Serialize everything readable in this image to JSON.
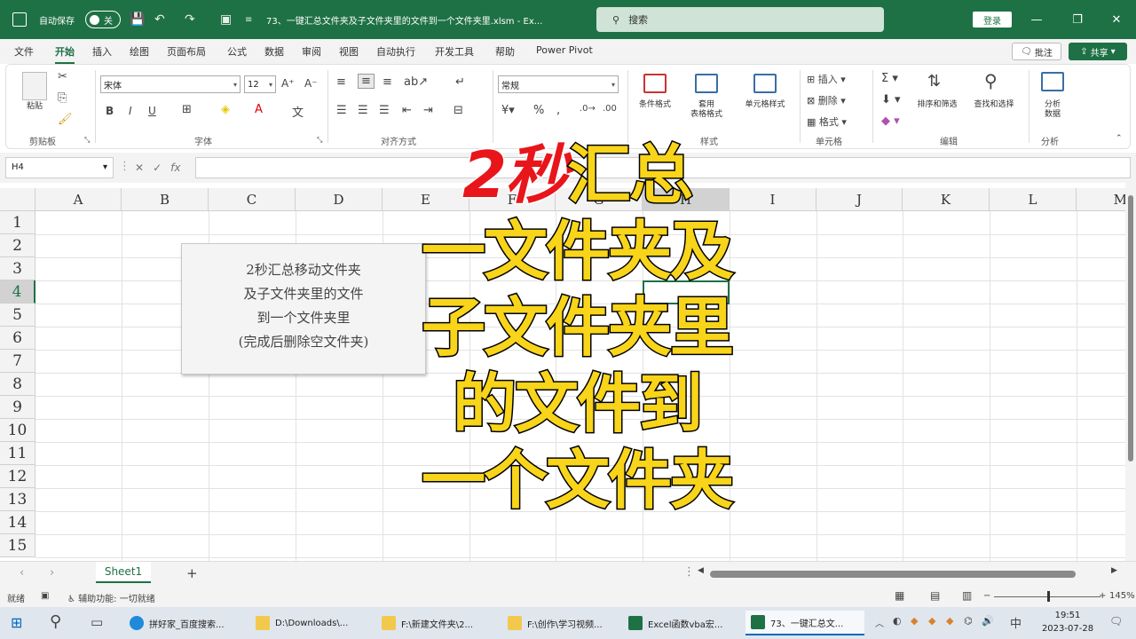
{
  "titlebar": {
    "autosave_label": "自动保存",
    "autosave_state": "关",
    "doc_title": "73、一键汇总文件夹及子文件夹里的文件到一个文件夹里.xlsm  -  Ex...",
    "search_placeholder": "搜索",
    "login_label": "登录"
  },
  "tabs": [
    "文件",
    "开始",
    "插入",
    "绘图",
    "页面布局",
    "公式",
    "数据",
    "审阅",
    "视图",
    "自动执行",
    "开发工具",
    "帮助",
    "Power Pivot"
  ],
  "comment_label": "批注",
  "share_label": "共享",
  "ribbon": {
    "clipboard": {
      "paste": "粘贴",
      "label": "剪贴板"
    },
    "font": {
      "name": "宋体",
      "size": "12",
      "label": "字体"
    },
    "alignment": {
      "label": "对齐方式"
    },
    "number": {
      "format": "常规",
      "label": "数字"
    },
    "styles": {
      "conditional": "条件格式",
      "table": "套用\n表格格式",
      "cell": "单元格样式",
      "label": "样式"
    },
    "cells": {
      "insert": "插入",
      "delete": "删除",
      "format": "格式",
      "label": "单元格"
    },
    "editing": {
      "sort": "排序和筛选",
      "find": "查找和选择",
      "label": "编辑"
    },
    "analysis": {
      "analyze": "分析\n数据",
      "label": "分析"
    }
  },
  "formula_bar": {
    "name_box": "H4",
    "fx": "fx"
  },
  "grid": {
    "columns": [
      "A",
      "B",
      "C",
      "D",
      "E",
      "F",
      "G",
      "H",
      "I",
      "J",
      "K",
      "L",
      "M"
    ],
    "rows": [
      "1",
      "2",
      "3",
      "4",
      "5",
      "6",
      "7",
      "8",
      "9",
      "10",
      "11",
      "12",
      "13",
      "14",
      "15"
    ],
    "selected_row": "4"
  },
  "textbox": {
    "lines": [
      "2秒汇总移动文件夹",
      "及子文件夹里的文件",
      "到一个文件夹里",
      "(完成后删除空文件夹)"
    ]
  },
  "overlay": {
    "line1_red": "2秒",
    "line1_yellow": "汇总",
    "line2": "一文件夹及",
    "line3": "子文件夹里",
    "line4": "的文件到",
    "line5": "一个文件夹"
  },
  "sheet_tab": "Sheet1",
  "status": {
    "ready": "就绪",
    "accessibility": "辅助功能: 一切就绪",
    "zoom": "145%"
  },
  "taskbar": {
    "items": [
      "拼好家_百度搜索...",
      "D:\\Downloads\\...",
      "F:\\新建文件夹\\2...",
      "F:\\创作\\学习视频...",
      "Excel函数vba宏...",
      "73、一键汇总文..."
    ],
    "ime": "中",
    "time": "19:51",
    "date": "2023-07-28"
  },
  "colors": {
    "excel_green": "#1e7145",
    "overlay_yellow": "#f8d41a",
    "overlay_red": "#e8151b"
  }
}
